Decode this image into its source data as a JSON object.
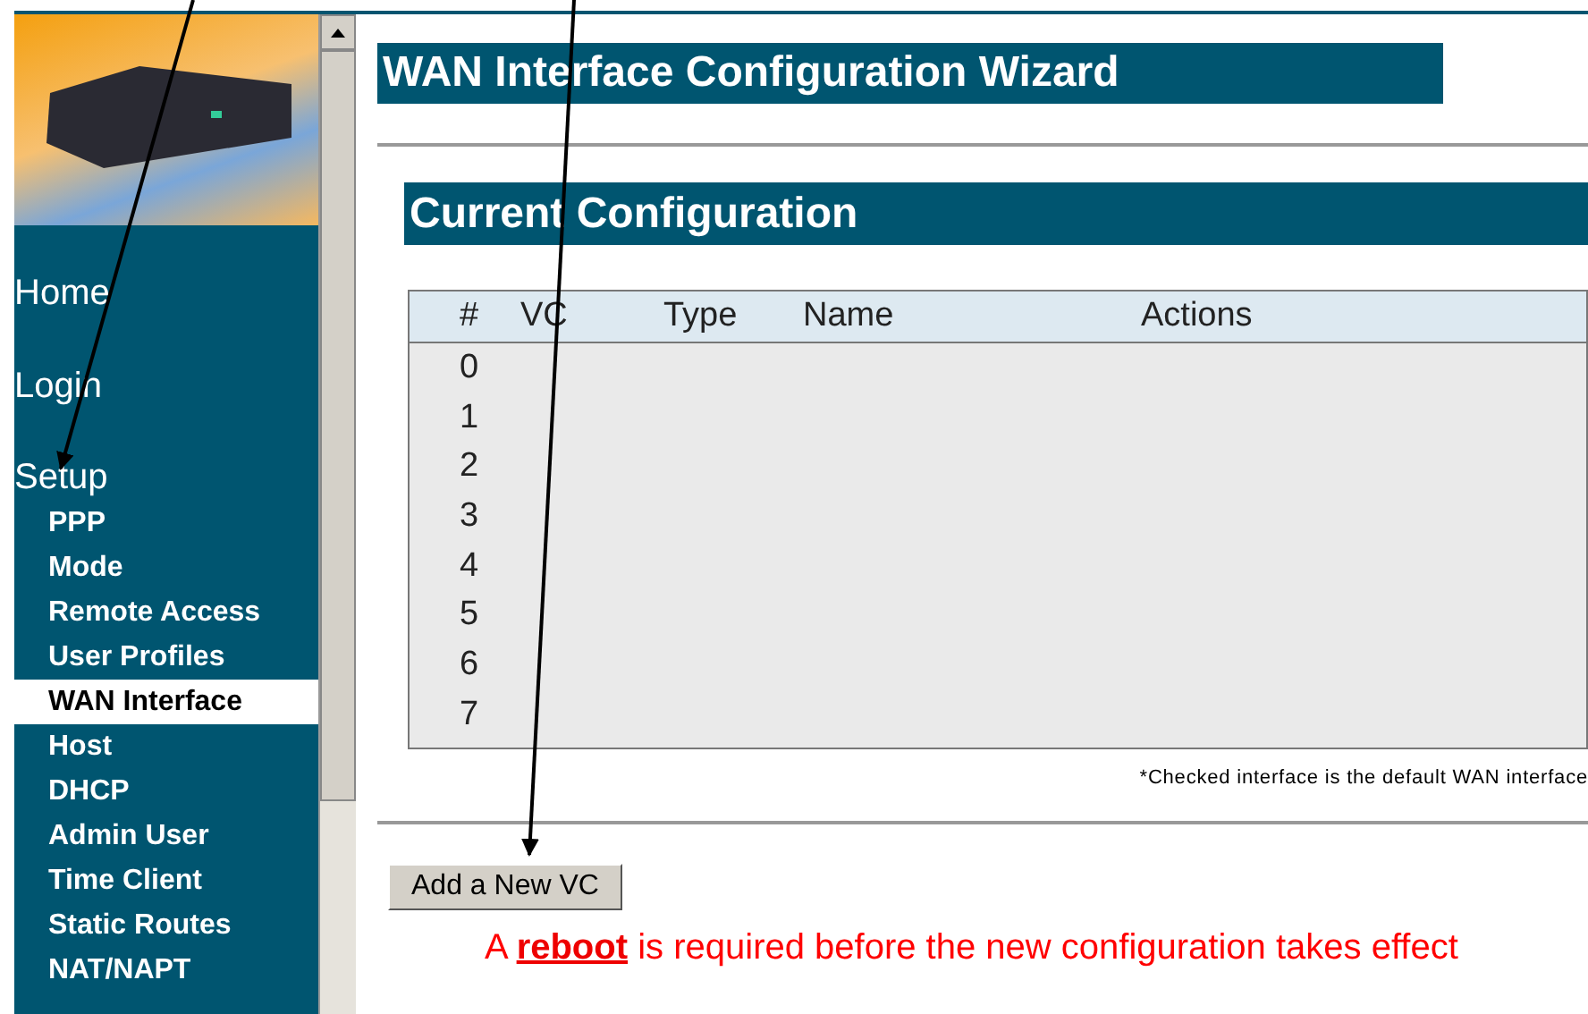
{
  "sidebar": {
    "main_items": [
      {
        "label": "Home"
      },
      {
        "label": "Login"
      },
      {
        "label": "Setup"
      }
    ],
    "setup_items": [
      {
        "label": "PPP",
        "selected": false
      },
      {
        "label": "Mode",
        "selected": false
      },
      {
        "label": "Remote Access",
        "selected": false
      },
      {
        "label": "User Profiles",
        "selected": false
      },
      {
        "label": "WAN Interface",
        "selected": true
      },
      {
        "label": "Host",
        "selected": false
      },
      {
        "label": "DHCP",
        "selected": false
      },
      {
        "label": "Admin User",
        "selected": false
      },
      {
        "label": "Time Client",
        "selected": false
      },
      {
        "label": "Static Routes",
        "selected": false
      },
      {
        "label": "NAT/NAPT",
        "selected": false
      }
    ]
  },
  "page_title": "WAN Interface Configuration Wizard",
  "section_title": "Current Configuration",
  "table": {
    "columns": [
      "#",
      "VC",
      "Type",
      "Name",
      "Actions"
    ],
    "rows": [
      "0",
      "1",
      "2",
      "3",
      "4",
      "5",
      "6",
      "7"
    ]
  },
  "footnote": "*Checked interface is the default WAN interface",
  "add_button": "Add a New VC",
  "notice": {
    "before": "A",
    "link": "reboot",
    "after": "is required before the new configuration takes effect"
  }
}
